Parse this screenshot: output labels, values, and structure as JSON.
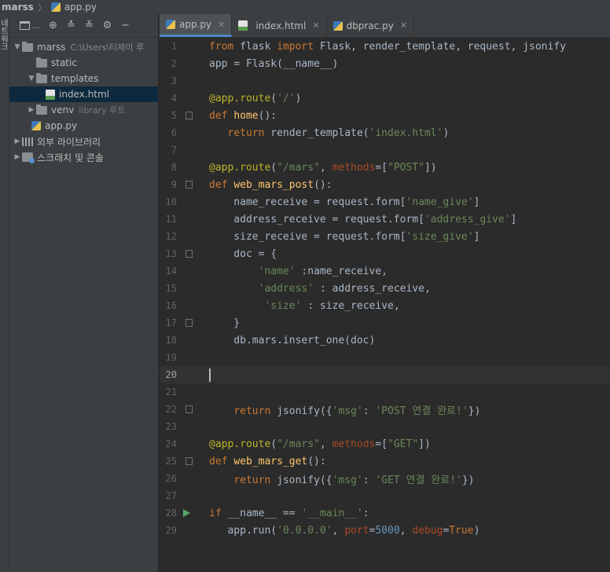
{
  "breadcrumb": {
    "project": "marss",
    "file": "app.py"
  },
  "left_strip": {
    "label_chars": [
      "네",
      "트",
      "워",
      "크"
    ]
  },
  "toolbar": {
    "dots": "..."
  },
  "tree": [
    {
      "label": "marss",
      "hint": "C:\\Users\\티제이 루",
      "depth": 0,
      "expanded": true,
      "icon": "folder-icon"
    },
    {
      "label": "static",
      "depth": 1,
      "icon": "folder-icon"
    },
    {
      "label": "templates",
      "depth": 1,
      "expanded": true,
      "icon": "folder-icon"
    },
    {
      "label": "index.html",
      "depth": 2,
      "icon": "html-file-icon",
      "selected": true
    },
    {
      "label": "venv",
      "hint": "library 루트",
      "depth": 1,
      "expanded": false,
      "icon": "folder-icon"
    },
    {
      "label": "app.py",
      "depth": 1,
      "icon": "python-file-icon"
    },
    {
      "label": "외부 라이브러리",
      "depth": 0,
      "expanded": false,
      "icon": "library-icon"
    },
    {
      "label": "스크래치 및 콘솔",
      "depth": 0,
      "expanded": false,
      "icon": "scratch-icon"
    }
  ],
  "tabs": [
    {
      "label": "app.py",
      "active": true,
      "icon": "python-file-icon"
    },
    {
      "label": "index.html",
      "active": false,
      "icon": "html-file-icon"
    },
    {
      "label": "dbprac.py",
      "active": false,
      "icon": "python-file-icon"
    }
  ],
  "editor": {
    "current_line": 20,
    "lines": [
      {
        "n": "1",
        "code": "from flask import Flask, render_template, request, jsonify"
      },
      {
        "n": "2",
        "code": "app = Flask(__name__)"
      },
      {
        "n": "3",
        "code": ""
      },
      {
        "n": "4",
        "code": "@app.route('/')"
      },
      {
        "n": "5",
        "code": "def home():"
      },
      {
        "n": "6",
        "code": "   return render_template('index.html')"
      },
      {
        "n": "7",
        "code": ""
      },
      {
        "n": "8",
        "code": "@app.route(\"/mars\", methods=[\"POST\"])"
      },
      {
        "n": "9",
        "code": "def web_mars_post():"
      },
      {
        "n": "10",
        "code": "    name_receive = request.form['name_give']"
      },
      {
        "n": "11",
        "code": "    address_receive = request.form['address_give']"
      },
      {
        "n": "12",
        "code": "    size_receive = request.form['size_give']"
      },
      {
        "n": "13",
        "code": "    doc = {"
      },
      {
        "n": "14",
        "code": "        'name' :name_receive,"
      },
      {
        "n": "15",
        "code": "        'address' : address_receive,"
      },
      {
        "n": "16",
        "code": "         'size' : size_receive,"
      },
      {
        "n": "17",
        "code": "    }"
      },
      {
        "n": "18",
        "code": "    db.mars.insert_one(doc)"
      },
      {
        "n": "19",
        "code": ""
      },
      {
        "n": "20",
        "code": ""
      },
      {
        "n": "21",
        "code": ""
      },
      {
        "n": "22",
        "code": "    return jsonify({'msg': 'POST 연결 완료!'})"
      },
      {
        "n": "23",
        "code": ""
      },
      {
        "n": "24",
        "code": "@app.route(\"/mars\", methods=[\"GET\"])"
      },
      {
        "n": "25",
        "code": "def web_mars_get():"
      },
      {
        "n": "26",
        "code": "    return jsonify({'msg': 'GET 연결 완료!'})"
      },
      {
        "n": "27",
        "code": ""
      },
      {
        "n": "28",
        "code": "if __name__ == '__main__':"
      },
      {
        "n": "29",
        "code": "   app.run('0.0.0.0', port=5000, debug=True)"
      }
    ]
  },
  "colors": {
    "accent": "#4a88c7",
    "keyword": "#cc7832",
    "string": "#6a8759",
    "decorator": "#bbb529",
    "function": "#ffc66d",
    "number": "#6897bb"
  }
}
